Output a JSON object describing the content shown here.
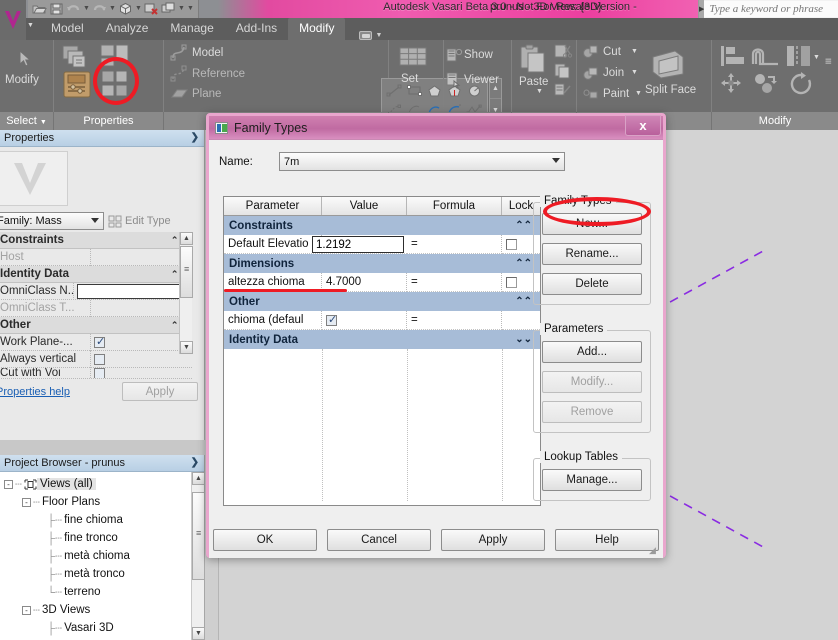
{
  "titlebar": {
    "app_title": "Autodesk Vasari Beta 3.0 - Not For Resale Version -",
    "document_title": "prunus - 3D View: {3D}",
    "search_placeholder": "Type a keyword or phrase",
    "qat": [
      {
        "name": "open-icon",
        "label": "Open"
      },
      {
        "name": "save-icon",
        "label": "Save"
      },
      {
        "name": "undo-icon",
        "label": "Undo"
      },
      {
        "name": "redo-icon",
        "label": "Redo"
      },
      {
        "name": "default-3d-view-icon",
        "label": "Default 3D View"
      },
      {
        "name": "close-hidden-windows-icon",
        "label": "Close Hidden Windows"
      },
      {
        "name": "switch-windows-icon",
        "label": "Switch Windows"
      }
    ]
  },
  "ribbon": {
    "tabs": [
      {
        "label": "Model",
        "active": false
      },
      {
        "label": "Analyze",
        "active": false
      },
      {
        "label": "Manage",
        "active": false
      },
      {
        "label": "Add-Ins",
        "active": false
      },
      {
        "label": "Modify",
        "active": true
      }
    ],
    "select_label": "Select",
    "panels": [
      {
        "title": "Properties",
        "label": "Modify"
      },
      {
        "title": "",
        "label": ""
      },
      {
        "title": "",
        "label": ""
      },
      {
        "title": "",
        "label": ""
      },
      {
        "title": "Modify",
        "label": ""
      }
    ],
    "modify_label": "Modify",
    "properties_label": "Properties",
    "work_plane": {
      "model": "Model",
      "reference": "Reference",
      "plane": "Plane",
      "set": "Set",
      "show": "Show",
      "viewer": "Viewer"
    },
    "clipboard": {
      "paste": "Paste"
    },
    "geometry": {
      "cut": "Cut",
      "join": "Join",
      "paint": "Paint",
      "split_face": "Split Face"
    },
    "modify_panel_label": "Modify"
  },
  "properties_palette": {
    "title": "Properties",
    "type_selector": "Family: Mass",
    "edit_type": "Edit Type",
    "rows": [
      {
        "type": "group",
        "name": "Constraints"
      },
      {
        "type": "param",
        "name": "Host",
        "value": "",
        "faded": true
      },
      {
        "type": "group",
        "name": "Identity Data"
      },
      {
        "type": "param",
        "name": "OmniClass N...",
        "value": "",
        "editing": true
      },
      {
        "type": "param",
        "name": "OmniClass T...",
        "value": "",
        "faded": true
      },
      {
        "type": "group",
        "name": "Other"
      },
      {
        "type": "check",
        "name": "Work Plane-...",
        "checked": true
      },
      {
        "type": "check",
        "name": "Always vertical",
        "checked": false
      },
      {
        "type": "check",
        "name": "Cut with Voi",
        "checked": false
      }
    ],
    "help_link": "Properties help",
    "apply_label": "Apply"
  },
  "project_browser": {
    "title": "Project Browser - prunus",
    "tree": [
      {
        "label": "Views (all)",
        "depth": 0,
        "expander": "-",
        "icon": "views-icon",
        "selected": true
      },
      {
        "label": "Floor Plans",
        "depth": 1,
        "expander": "-",
        "icon": "",
        "selected": false
      },
      {
        "label": "fine chioma",
        "depth": 2,
        "expander": "",
        "icon": "",
        "selected": false
      },
      {
        "label": "fine tronco",
        "depth": 2,
        "expander": "",
        "icon": "",
        "selected": false
      },
      {
        "label": "metà chioma",
        "depth": 2,
        "expander": "",
        "icon": "",
        "selected": false
      },
      {
        "label": "metà tronco",
        "depth": 2,
        "expander": "",
        "icon": "",
        "selected": false
      },
      {
        "label": "terreno",
        "depth": 2,
        "expander": "",
        "icon": "",
        "selected": false
      },
      {
        "label": "3D Views",
        "depth": 1,
        "expander": "-",
        "icon": "",
        "selected": false
      },
      {
        "label": "Vasari 3D",
        "depth": 2,
        "expander": "",
        "icon": "",
        "selected": false
      }
    ]
  },
  "dialog": {
    "title": "Family Types",
    "close_label": "x",
    "name_label": "Name:",
    "name_value": "7m",
    "columns": [
      "Parameter",
      "Value",
      "Formula",
      "Lock"
    ],
    "rows": [
      {
        "kind": "group",
        "label": "Constraints",
        "chevron": "«"
      },
      {
        "kind": "param",
        "parameter": "Default Elevatio",
        "value": "1.2192",
        "formula": "=",
        "lock": false,
        "editing": true
      },
      {
        "kind": "group",
        "label": "Dimensions",
        "chevron": "«"
      },
      {
        "kind": "param",
        "parameter": "altezza chioma",
        "value": "4.7000",
        "formula": "=",
        "lock": false,
        "editing": false,
        "underlined": true
      },
      {
        "kind": "group",
        "label": "Other",
        "chevron": "«"
      },
      {
        "kind": "check",
        "parameter": "chioma (defaul",
        "checked": true,
        "formula": "=",
        "lock": false
      },
      {
        "kind": "group",
        "label": "Identity Data",
        "chevron": "»"
      }
    ],
    "family_types_group": {
      "caption": "Family Types",
      "buttons": [
        {
          "label": "New...",
          "enabled": true,
          "highlighted": true
        },
        {
          "label": "Rename...",
          "enabled": true,
          "highlighted": false
        },
        {
          "label": "Delete",
          "enabled": true,
          "highlighted": false
        }
      ]
    },
    "parameters_group": {
      "caption": "Parameters",
      "buttons": [
        {
          "label": "Add...",
          "enabled": true
        },
        {
          "label": "Modify...",
          "enabled": false
        },
        {
          "label": "Remove",
          "enabled": false
        }
      ]
    },
    "lookup_tables_group": {
      "caption": "Lookup Tables",
      "buttons": [
        {
          "label": "Manage...",
          "enabled": true
        }
      ]
    },
    "footer_buttons": [
      {
        "label": "OK"
      },
      {
        "label": "Cancel"
      },
      {
        "label": "Apply"
      },
      {
        "label": "Help"
      }
    ]
  },
  "annotations": {
    "ellipse_ribbon": {
      "name": "properties-button-highlight"
    },
    "ellipse_new": {
      "name": "new-button-highlight"
    },
    "underline_altezza": {
      "name": "altezza-chioma-underline"
    },
    "color": "#ee1b24"
  },
  "viewport": {
    "model_name": "prunus-tree-mass",
    "reference_line_color": "#8a2be2",
    "background": "#d3d3d3"
  },
  "colors": {
    "title_pink": "#ec3f9f",
    "dialog_border_pink": "#e9a6cd",
    "ribbon_gray": "#6e6e6e",
    "group_row_blue": "#a7bcd7",
    "accent_red": "#ee1b24"
  }
}
